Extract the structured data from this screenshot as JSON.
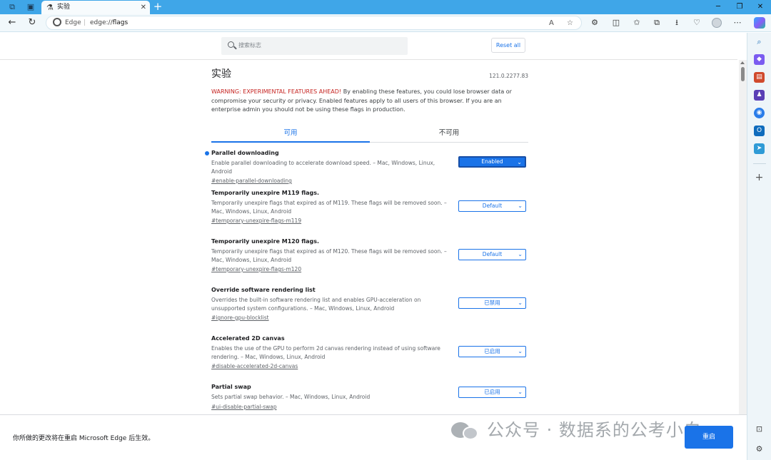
{
  "tab": {
    "title": "实验"
  },
  "address": {
    "host": "Edge",
    "url_prefix": "edge://",
    "url_path": "flags"
  },
  "search": {
    "placeholder": "搜索标志"
  },
  "reset_label": "Reset all",
  "page": {
    "title": "实验",
    "version": "121.0.2277.83",
    "warning_red": "WARNING: EXPERIMENTAL FEATURES AHEAD!",
    "warning_text": " By enabling these features, you could lose browser data or compromise your security or privacy. Enabled features apply to all users of this browser. If you are an enterprise admin you should not be using these flags in production."
  },
  "tabs": {
    "available": "可用",
    "unavailable": "不可用"
  },
  "flags": [
    {
      "name": "Parallel downloading",
      "desc": "Enable parallel downloading to accelerate download speed. – Mac, Windows, Linux, Android",
      "link": "#enable-parallel-downloading",
      "value": "Enabled"
    },
    {
      "name": "Temporarily unexpire M119 flags.",
      "desc": "Temporarily unexpire flags that expired as of M119. These flags will be removed soon. – Mac, Windows, Linux, Android",
      "link": "#temporary-unexpire-flags-m119",
      "value": "Default"
    },
    {
      "name": "Temporarily unexpire M120 flags.",
      "desc": "Temporarily unexpire flags that expired as of M120. These flags will be removed soon. – Mac, Windows, Linux, Android",
      "link": "#temporary-unexpire-flags-m120",
      "value": "Default"
    },
    {
      "name": "Override software rendering list",
      "desc": "Overrides the built-in software rendering list and enables GPU-acceleration on unsupported system configurations. – Mac, Windows, Linux, Android",
      "link": "#ignore-gpu-blocklist",
      "value": "已禁用"
    },
    {
      "name": "Accelerated 2D canvas",
      "desc": "Enables the use of the GPU to perform 2d canvas rendering instead of using software rendering. – Mac, Windows, Linux, Android",
      "link": "#disable-accelerated-2d-canvas",
      "value": "已启用"
    },
    {
      "name": "Partial swap",
      "desc": "Sets partial swap behavior. – Mac, Windows, Linux, Android",
      "link": "#ui-disable-partial-swap",
      "value": "已启用"
    }
  ],
  "bottom": {
    "message": "你所做的更改将在重启 Microsoft Edge 后生效。",
    "relaunch_label": "重启"
  },
  "watermark": {
    "text": "公众号 · 数据系的公考小白"
  },
  "colors": {
    "accent": "#1a73e8",
    "warning": "#c5221f",
    "tabbar": "#3fa6e8"
  }
}
